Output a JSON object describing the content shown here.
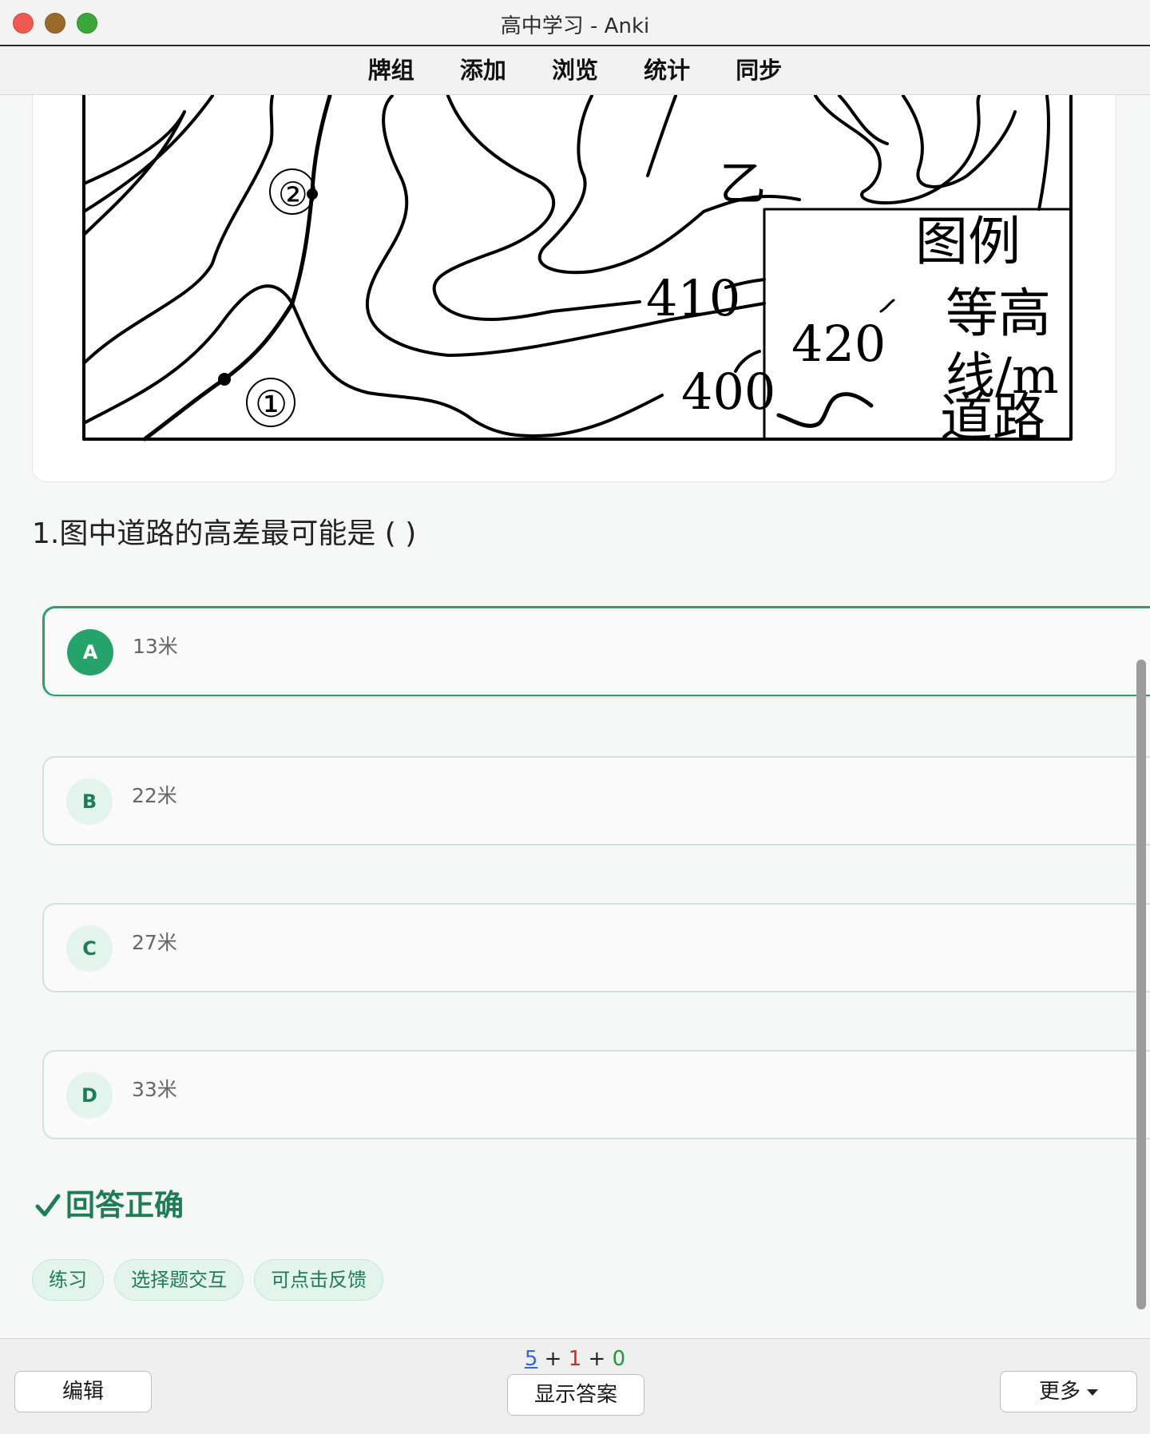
{
  "window": {
    "title": "高中学习 - Anki"
  },
  "nav": {
    "items": [
      "牌组",
      "添加",
      "浏览",
      "统计",
      "同步"
    ]
  },
  "figure": {
    "labels": {
      "point2": "②",
      "point1": "①",
      "yi": "乙",
      "c410": "410",
      "c420": "420",
      "c400": "400"
    },
    "legend": {
      "title": "图例",
      "contour_label": "等高",
      "contour_unit": "线/m",
      "road_label": "道路"
    }
  },
  "question": {
    "text": "1.图中道路的高差最可能是 ( )"
  },
  "options": [
    {
      "letter": "A",
      "text": "13米",
      "selected": true
    },
    {
      "letter": "B",
      "text": "22米",
      "selected": false
    },
    {
      "letter": "C",
      "text": "27米",
      "selected": false
    },
    {
      "letter": "D",
      "text": "33米",
      "selected": false
    }
  ],
  "result": {
    "icon": "check-icon",
    "text": "回答正确",
    "color": "#1e7d55"
  },
  "tags": [
    "练习",
    "选择题交互",
    "可点击反馈"
  ],
  "bottom": {
    "counts": {
      "new": "5",
      "learn": "1",
      "review": "0",
      "plus": "+"
    },
    "edit_label": "编辑",
    "show_answer_label": "显示答案",
    "more_label": "更多"
  },
  "colors": {
    "accent": "#26a36a",
    "new": "#2e6bd8",
    "learn": "#dd2222",
    "review": "#1d9a3c"
  }
}
